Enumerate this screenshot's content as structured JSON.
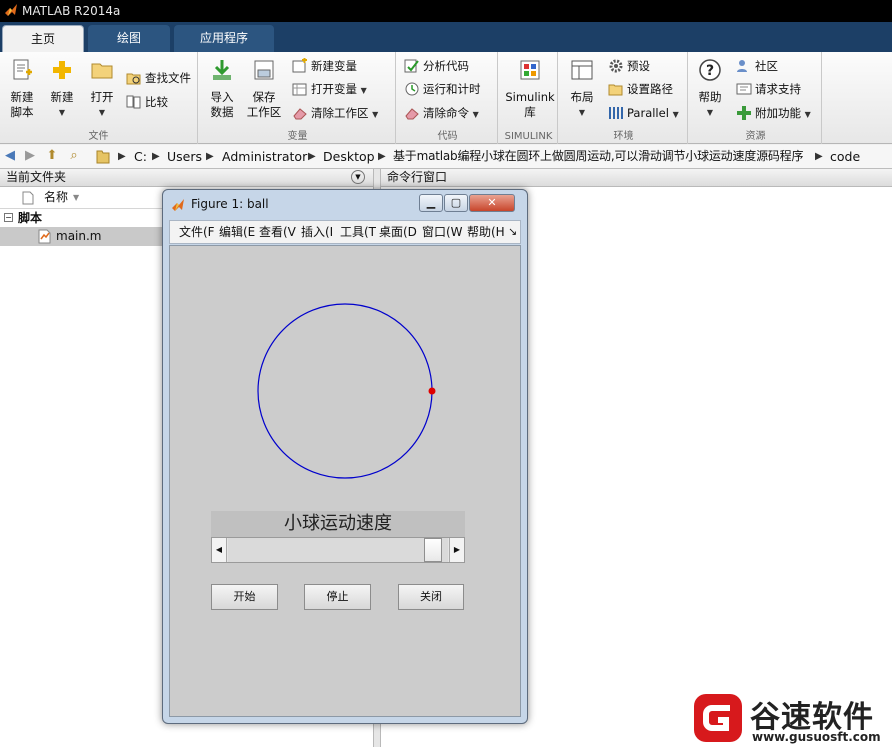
{
  "window": {
    "title": "MATLAB R2014a"
  },
  "tabs": [
    {
      "label": "主页",
      "active": true
    },
    {
      "label": "绘图",
      "active": false
    },
    {
      "label": "应用程序",
      "active": false
    }
  ],
  "ribbon": {
    "file": {
      "label": "文件",
      "new_script": {
        "line1": "新建",
        "line2": "脚本"
      },
      "new": "新建",
      "open": "打开",
      "find_files": "查找文件",
      "compare": "比较"
    },
    "variable": {
      "label": "变量",
      "import": {
        "line1": "导入",
        "line2": "数据"
      },
      "save_ws": {
        "line1": "保存",
        "line2": "工作区"
      },
      "new_var": "新建变量",
      "open_var": "打开变量",
      "clear_ws": "清除工作区"
    },
    "code": {
      "label": "代码",
      "analyze": "分析代码",
      "run_time": "运行和计时",
      "clear_cmd": "清除命令"
    },
    "simulink": {
      "label": "SIMULINK",
      "lib": {
        "line1": "Simulink",
        "line2": "库"
      }
    },
    "env": {
      "label": "环境",
      "layout": "布局",
      "prefs": "预设",
      "set_path": "设置路径",
      "parallel": "Parallel"
    },
    "resources": {
      "label": "资源",
      "help": "帮助",
      "community": "社区",
      "support": "请求支持",
      "addons": "附加功能"
    }
  },
  "path": [
    "C:",
    "Users",
    "Administrator",
    "Desktop",
    "基于matlab编程小球在圆环上做圆周运动,可以滑动调节小球运动速度源码程序",
    "code"
  ],
  "current_folder": {
    "title": "当前文件夹",
    "column": "名称",
    "group": "脚本",
    "files": [
      "main.m"
    ]
  },
  "command_window": {
    "title": "命令行窗口"
  },
  "figure": {
    "title": "Figure 1: ball",
    "menu": [
      "文件(F",
      "编辑(E",
      "查看(V",
      "插入(I",
      "工具(T",
      "桌面(D",
      "窗口(W",
      "帮助(H"
    ],
    "speed_label": "小球运动速度",
    "slider_value": 0.97,
    "buttons": {
      "start": "开始",
      "stop": "停止",
      "close": "关闭"
    },
    "colors": {
      "circle": "#0000cc",
      "ball": "#e00000"
    },
    "ball_angle_deg": 0
  },
  "watermark": {
    "brand": "谷速软件",
    "url": "www.gusuosft.com"
  }
}
